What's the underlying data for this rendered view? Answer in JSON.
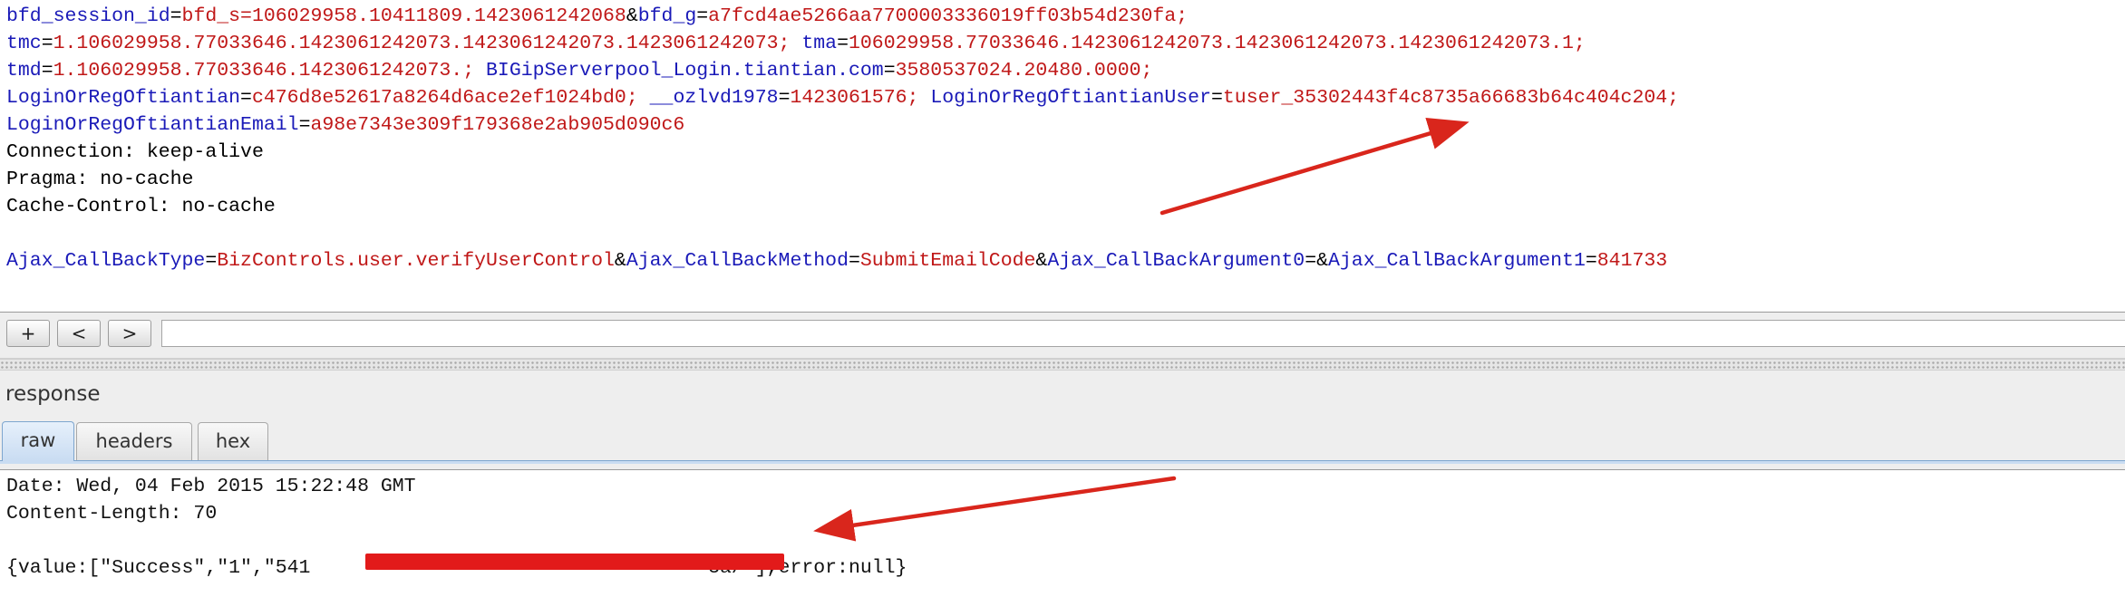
{
  "request": {
    "lines": [
      [
        [
          "bfd_session_id",
          "k"
        ],
        [
          "=",
          "p"
        ],
        [
          "bfd_s=106029958.10411809.1423061242068",
          "v"
        ],
        [
          "&",
          "p"
        ],
        [
          "bfd_g",
          "k"
        ],
        [
          "=",
          "p"
        ],
        [
          "a7fcd4ae5266aa7700003336019ff03b54d230fa;",
          "v"
        ]
      ],
      [
        [
          "tmc",
          "k"
        ],
        [
          "=",
          "p"
        ],
        [
          "1.106029958.77033646.1423061242073.1423061242073.1423061242073;",
          "v"
        ],
        [
          " ",
          "p"
        ],
        [
          "tma",
          "k"
        ],
        [
          "=",
          "p"
        ],
        [
          "106029958.77033646.1423061242073.1423061242073.1423061242073.1;",
          "v"
        ]
      ],
      [
        [
          "tmd",
          "k"
        ],
        [
          "=",
          "p"
        ],
        [
          "1.106029958.77033646.1423061242073.;",
          "v"
        ],
        [
          " ",
          "p"
        ],
        [
          "BIGipServerpool_Login.tiantian.com",
          "k"
        ],
        [
          "=",
          "p"
        ],
        [
          "3580537024.20480.0000;",
          "v"
        ]
      ],
      [
        [
          "LoginOrRegOftiantian",
          "k"
        ],
        [
          "=",
          "p"
        ],
        [
          "c476d8e52617a8264d6ace2ef1024bd0;",
          "v"
        ],
        [
          " ",
          "p"
        ],
        [
          "__ozlvd1978",
          "k"
        ],
        [
          "=",
          "p"
        ],
        [
          "1423061576;",
          "v"
        ],
        [
          " ",
          "p"
        ],
        [
          "LoginOrRegOftiantianUser",
          "k"
        ],
        [
          "=",
          "p"
        ],
        [
          "tuser_35302443f4c8735a66683b64c404c204;",
          "v"
        ]
      ],
      [
        [
          "LoginOrRegOftiantianEmail",
          "k"
        ],
        [
          "=",
          "p"
        ],
        [
          "a98e7343e309f179368e2ab905d090c6",
          "v"
        ]
      ],
      [
        [
          "Connection: keep-alive",
          "t"
        ]
      ],
      [
        [
          "Pragma: no-cache",
          "t"
        ]
      ],
      [
        [
          "Cache-Control: no-cache",
          "t"
        ]
      ],
      [
        [
          "",
          "t"
        ]
      ],
      [
        [
          "Ajax_CallBackType",
          "k"
        ],
        [
          "=",
          "p"
        ],
        [
          "BizControls.user.verifyUserControl",
          "v"
        ],
        [
          "&",
          "p"
        ],
        [
          "Ajax_CallBackMethod",
          "k"
        ],
        [
          "=",
          "p"
        ],
        [
          "SubmitEmailCode",
          "v"
        ],
        [
          "&",
          "p"
        ],
        [
          "Ajax_CallBackArgument0",
          "k"
        ],
        [
          "=&",
          "p"
        ],
        [
          "Ajax_CallBackArgument1",
          "k"
        ],
        [
          "=",
          "p"
        ],
        [
          "841733",
          "v"
        ]
      ]
    ]
  },
  "toolbar": {
    "add_label": "+",
    "prev_label": "<",
    "next_label": ">",
    "search_value": ""
  },
  "response": {
    "title": "response",
    "tabs": [
      {
        "label": "raw",
        "active": true
      },
      {
        "label": "headers",
        "active": false
      },
      {
        "label": "hex",
        "active": false
      }
    ],
    "lines": [
      "Date: Wed, 04 Feb 2015 15:22:48 GMT",
      "Content-Length: 70",
      "",
      "{value:[\"Success\",\"1\",\"541                                  3a/\"],error:null}"
    ]
  },
  "colors": {
    "key": "#1a1ab8",
    "value": "#c01818",
    "annotation_arrow": "#d9261c",
    "redaction": "#e21a1a"
  }
}
